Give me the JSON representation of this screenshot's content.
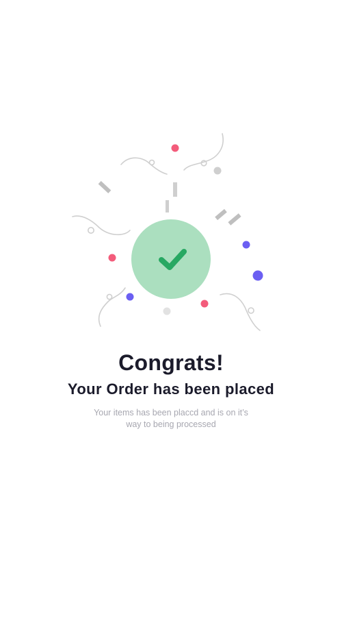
{
  "success": {
    "title": "Congrats!",
    "subtitle": "Your Order has been placed",
    "message": "Your items has been placcd and is on it’s way to being processed"
  },
  "icons": {
    "status": "check-icon",
    "decoration": "confetti"
  },
  "colors": {
    "badge_fill": "#abdfbf",
    "check": "#27a862",
    "confetti_pink": "#f35c7b",
    "confetti_purple": "#6b5ff2",
    "confetti_gray": "#c7c7c7",
    "text_dark": "#1b1b2b",
    "text_muted": "#a7a7b0"
  }
}
